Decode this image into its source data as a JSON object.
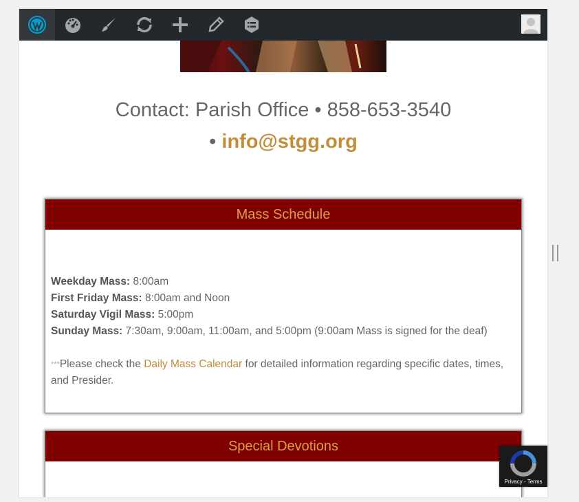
{
  "adminbar": {
    "items": [
      {
        "icon": "wordpress-logo-icon"
      },
      {
        "icon": "dashboard-icon"
      },
      {
        "icon": "customize-brush-icon"
      },
      {
        "icon": "updates-icon"
      },
      {
        "icon": "new-content-plus-icon"
      },
      {
        "icon": "edit-pencil-icon"
      },
      {
        "icon": "list-icon"
      }
    ],
    "avatar": "avatar-icon"
  },
  "contact": {
    "line1": "Contact:  Parish Office • 858-653-3540",
    "line2_prefix": "• ",
    "email": "info@stgg.org"
  },
  "mass_schedule": {
    "title": "Mass Schedule",
    "rows": [
      {
        "label": "Weekday Mass:",
        "value": " 8:00am"
      },
      {
        "label": "First Friday Mass:",
        "value": " 8:00am and Noon"
      },
      {
        "label": "Saturday Vigil Mass:",
        "value": " 5:00pm"
      },
      {
        "label": "Sunday Mass:",
        "value": " 7:30am, 9:00am, 11:00am, and 5:00pm  (9:00am Mass is signed for the deaf)"
      }
    ],
    "note_stars": "***",
    "note_before": "Please check the ",
    "note_link": "Daily Mass Calendar",
    "note_after": " for detailed information regarding specific dates, times, and Presider."
  },
  "special_devotions": {
    "title": "Special Devotions"
  },
  "recaptcha": {
    "links": "Privacy - Terms"
  },
  "colors": {
    "adminbar": "#23282d",
    "header_bg": "#800000",
    "header_text": "#d9a045",
    "link": "#c48d3a"
  }
}
